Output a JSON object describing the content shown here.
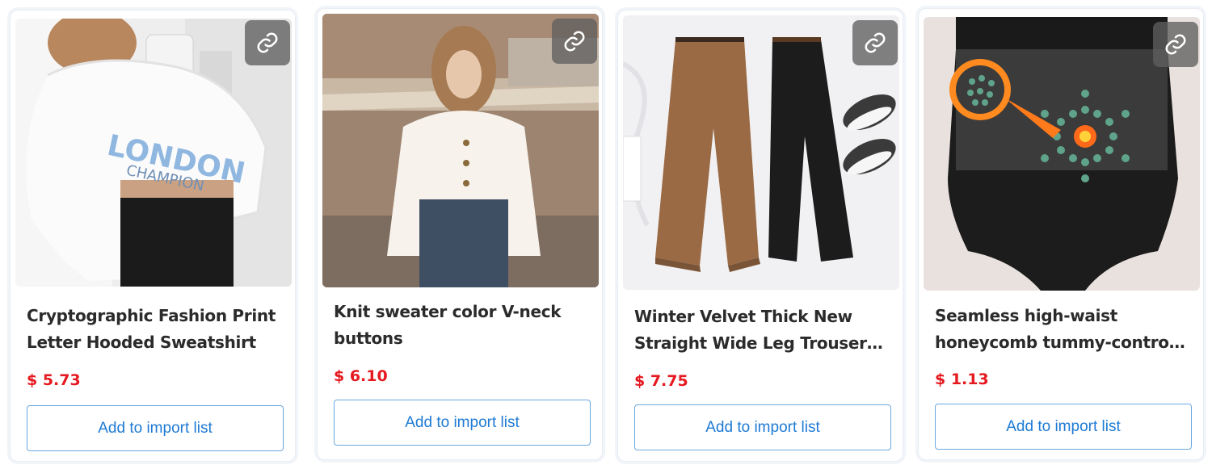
{
  "products": [
    {
      "title": "Cryptographic Fashion Print Letter Hooded Sweatshirt",
      "price": "$ 5.73",
      "button": "Add to import list",
      "image": "white cropped hoodie with blue letter print"
    },
    {
      "title": "Knit sweater color V-neck buttons",
      "price": "$ 6.10",
      "button": "Add to import list",
      "image": "woman in white knit cardigan"
    },
    {
      "title": "Winter Velvet Thick New Straight Wide Leg Trousers Women",
      "price": "$ 7.75",
      "button": "Add to import list",
      "image": "brown and black corduroy trousers"
    },
    {
      "title": "Seamless high-waist honeycomb tummy-control shaping underwear",
      "price": "$ 1.13",
      "button": "Add to import list",
      "image": "black high-waist shaping briefs"
    }
  ],
  "icons": {
    "link": "link-icon"
  },
  "colors": {
    "price": "#e5191f",
    "button_text": "#1e7ad4",
    "button_border": "#6aa8e0"
  }
}
